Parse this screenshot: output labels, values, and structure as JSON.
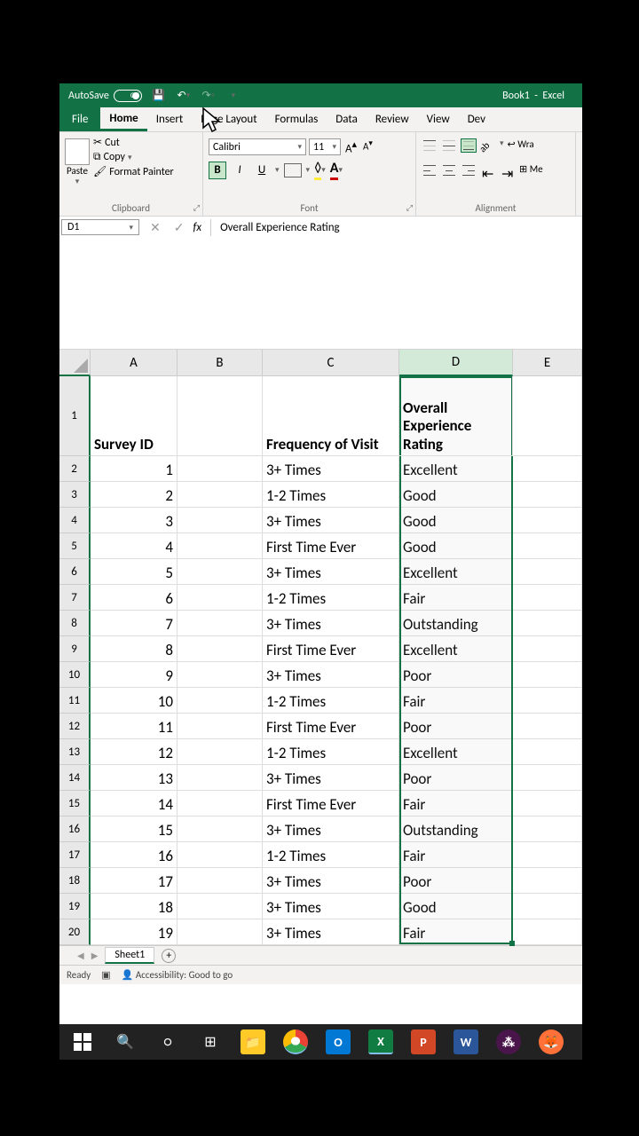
{
  "titlebar": {
    "autosave": "AutoSave",
    "toggle_state": "Off",
    "book": "Book1",
    "app": "Excel"
  },
  "ribbon": {
    "tabs": {
      "file": "File",
      "home": "Home",
      "insert": "Insert",
      "pagelayout": "Page Layout",
      "formulas": "Formulas",
      "data": "Data",
      "review": "Review",
      "view": "View",
      "dev": "Dev"
    },
    "clipboard": {
      "paste": "Paste",
      "cut": "Cut",
      "copy": "Copy",
      "format_painter": "Format Painter",
      "label": "Clipboard"
    },
    "font": {
      "name": "Calibri",
      "size": "11",
      "label": "Font"
    },
    "alignment": {
      "label": "Alignment",
      "wrap": "Wra",
      "merge": "Me"
    }
  },
  "formula_bar": {
    "namebox": "D1",
    "value": "Overall Experience Rating"
  },
  "columns": {
    "a": "A",
    "b": "B",
    "c": "C",
    "d": "D",
    "e": "E"
  },
  "headers": {
    "a": "Survey ID",
    "c": "Frequency of Visit",
    "d": "Overall Experience Rating"
  },
  "rows": [
    {
      "n": "1",
      "id": "",
      "freq": "",
      "rating": ""
    },
    {
      "n": "2",
      "id": "1",
      "freq": "3+ Times",
      "rating": "Excellent"
    },
    {
      "n": "3",
      "id": "2",
      "freq": "1-2 Times",
      "rating": "Good"
    },
    {
      "n": "4",
      "id": "3",
      "freq": "3+ Times",
      "rating": "Good"
    },
    {
      "n": "5",
      "id": "4",
      "freq": "First Time Ever",
      "rating": "Good"
    },
    {
      "n": "6",
      "id": "5",
      "freq": "3+ Times",
      "rating": "Excellent"
    },
    {
      "n": "7",
      "id": "6",
      "freq": "1-2 Times",
      "rating": "Fair"
    },
    {
      "n": "8",
      "id": "7",
      "freq": "3+ Times",
      "rating": "Outstanding"
    },
    {
      "n": "9",
      "id": "8",
      "freq": "First Time Ever",
      "rating": "Excellent"
    },
    {
      "n": "10",
      "id": "9",
      "freq": "3+ Times",
      "rating": "Poor"
    },
    {
      "n": "11",
      "id": "10",
      "freq": "1-2 Times",
      "rating": "Fair"
    },
    {
      "n": "12",
      "id": "11",
      "freq": "First Time Ever",
      "rating": "Poor"
    },
    {
      "n": "13",
      "id": "12",
      "freq": "1-2 Times",
      "rating": "Excellent"
    },
    {
      "n": "14",
      "id": "13",
      "freq": "3+ Times",
      "rating": "Poor"
    },
    {
      "n": "15",
      "id": "14",
      "freq": "First Time Ever",
      "rating": "Fair"
    },
    {
      "n": "16",
      "id": "15",
      "freq": "3+ Times",
      "rating": "Outstanding"
    },
    {
      "n": "17",
      "id": "16",
      "freq": "1-2 Times",
      "rating": "Fair"
    },
    {
      "n": "18",
      "id": "17",
      "freq": "3+ Times",
      "rating": "Poor"
    },
    {
      "n": "19",
      "id": "18",
      "freq": "3+ Times",
      "rating": "Good"
    },
    {
      "n": "20",
      "id": "19",
      "freq": "3+ Times",
      "rating": "Fair"
    }
  ],
  "sheet": {
    "name": "Sheet1"
  },
  "statusbar": {
    "ready": "Ready",
    "accessibility": "Accessibility: Good to go"
  }
}
